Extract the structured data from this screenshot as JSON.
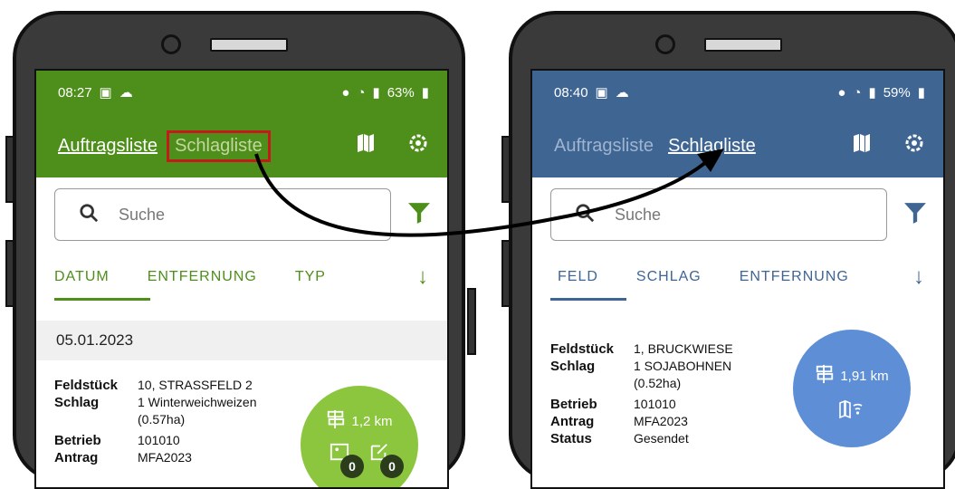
{
  "colors": {
    "left_theme": "#4e8e1a",
    "right_theme": "#3f6593",
    "left_badge": "#8cc63f",
    "right_badge": "#5e8fd6",
    "highlight": "#c41a1a"
  },
  "left": {
    "status": {
      "time": "08:27",
      "battery": "63%"
    },
    "appbar": {
      "tab1": "Auftragsliste",
      "tab2": "Schlagliste"
    },
    "search": {
      "placeholder": "Suche"
    },
    "tabs": [
      "DATUM",
      "ENTFERNUNG",
      "TYP"
    ],
    "date_header": "05.01.2023",
    "card": {
      "rows": [
        {
          "k": "Feldstück",
          "v": "10, STRASSFELD 2"
        },
        {
          "k": "Schlag",
          "v": "1 Winterweichweizen (0.57ha)"
        },
        {
          "k": "Betrieb",
          "v": "101010"
        },
        {
          "k": "Antrag",
          "v": "MFA2023"
        }
      ],
      "distance": "1,2 km",
      "photo_count": "0",
      "note_count": "0"
    }
  },
  "right": {
    "status": {
      "time": "08:40",
      "battery": "59%"
    },
    "appbar": {
      "tab1": "Auftragsliste",
      "tab2": "Schlagliste"
    },
    "search": {
      "placeholder": "Suche"
    },
    "tabs": [
      "FELD",
      "SCHLAG",
      "ENTFERNUNG"
    ],
    "card": {
      "rows": [
        {
          "k": "Feldstück",
          "v": "1, BRUCKWIESE"
        },
        {
          "k": "Schlag",
          "v": "1 SOJABOHNEN (0.52ha)"
        },
        {
          "k": "Betrieb",
          "v": "101010"
        },
        {
          "k": "Antrag",
          "v": "MFA2023"
        },
        {
          "k": "Status",
          "v": "Gesendet"
        }
      ],
      "distance": "1,91 km"
    }
  }
}
